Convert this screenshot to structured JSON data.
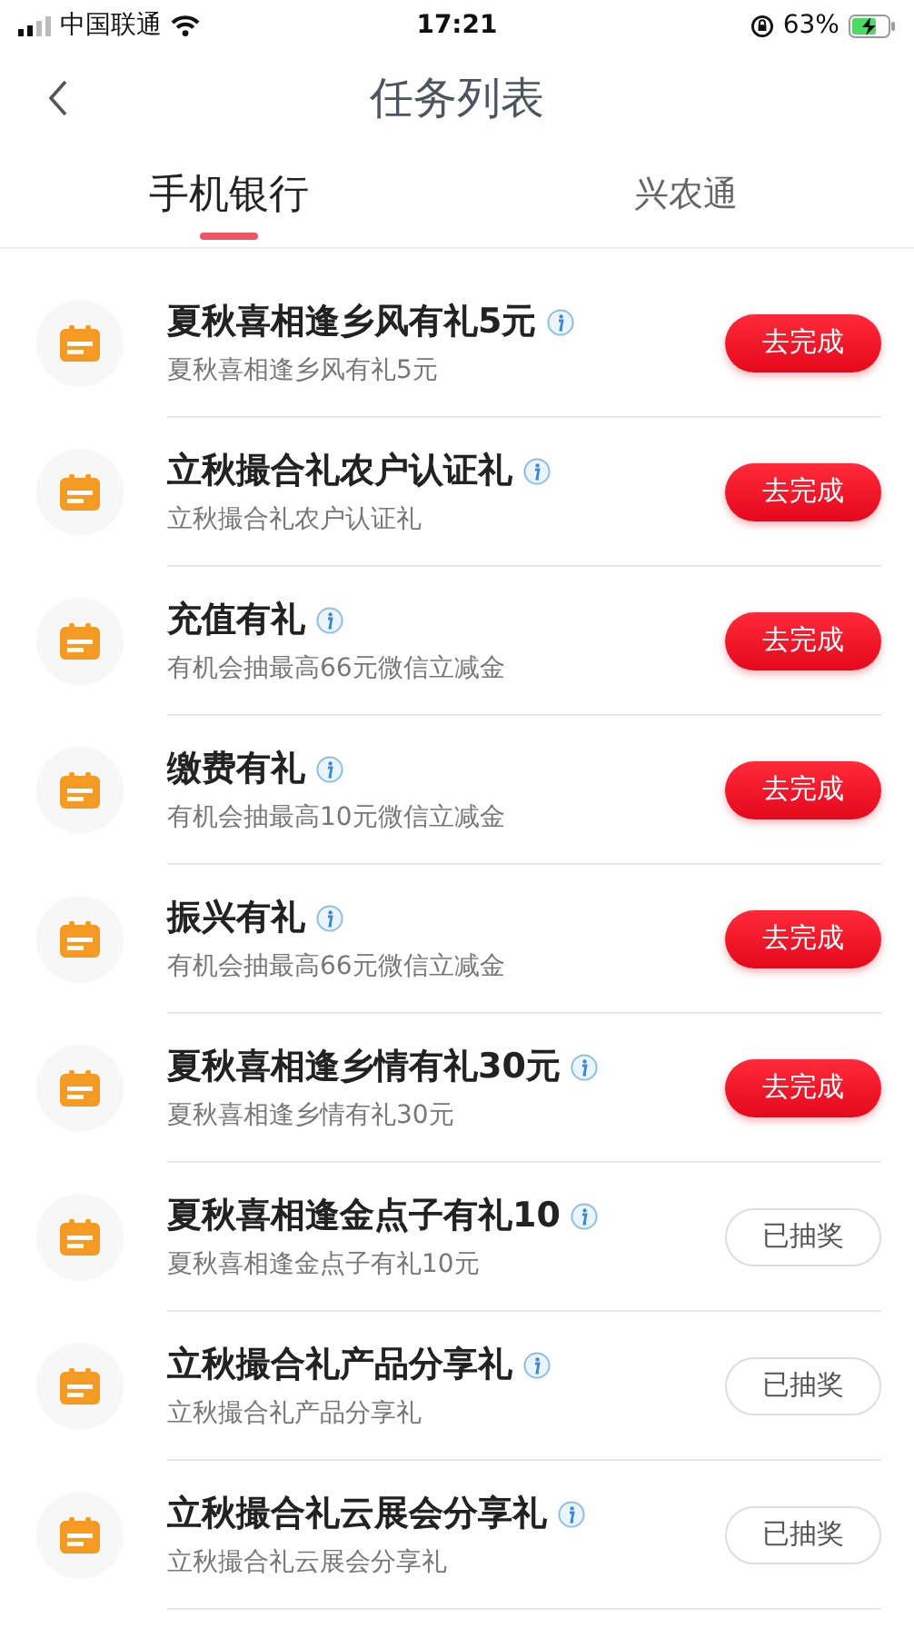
{
  "status_bar": {
    "carrier": "中国联通",
    "time": "17:21",
    "battery": "63%"
  },
  "header": {
    "title": "任务列表"
  },
  "tabs": [
    {
      "label": "手机银行",
      "selected": true
    },
    {
      "label": "兴农通",
      "selected": false
    }
  ],
  "tasks": [
    {
      "title": "夏秋喜相逢乡风有礼5元",
      "subtitle": "夏秋喜相逢乡风有礼5元",
      "button": "去完成",
      "kind": "todo"
    },
    {
      "title": "立秋撮合礼农户认证礼",
      "subtitle": "立秋撮合礼农户认证礼",
      "button": "去完成",
      "kind": "todo"
    },
    {
      "title": "充值有礼",
      "subtitle": "有机会抽最高66元微信立减金",
      "button": "去完成",
      "kind": "todo"
    },
    {
      "title": "缴费有礼",
      "subtitle": "有机会抽最高10元微信立减金",
      "button": "去完成",
      "kind": "todo"
    },
    {
      "title": "振兴有礼",
      "subtitle": "有机会抽最高66元微信立减金",
      "button": "去完成",
      "kind": "todo"
    },
    {
      "title": "夏秋喜相逢乡情有礼30元",
      "subtitle": "夏秋喜相逢乡情有礼30元",
      "button": "去完成",
      "kind": "todo"
    },
    {
      "title": "夏秋喜相逢金点子有礼10",
      "subtitle": "夏秋喜相逢金点子有礼10元",
      "button": "已抽奖",
      "kind": "done"
    },
    {
      "title": "立秋撮合礼产品分享礼",
      "subtitle": "立秋撮合礼产品分享礼",
      "button": "已抽奖",
      "kind": "done"
    },
    {
      "title": "立秋撮合礼云展会分享礼",
      "subtitle": "立秋撮合礼云展会分享礼",
      "button": "已抽奖",
      "kind": "done"
    }
  ]
}
